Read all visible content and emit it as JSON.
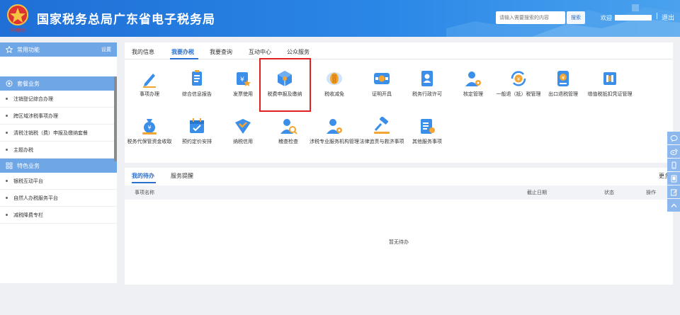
{
  "header": {
    "site_title": "国家税务总局广东省电子税务局",
    "search_placeholder": "请输入需要搜索的内容",
    "search_label": "搜索",
    "welcome": "欢迎",
    "separator": "|",
    "logout_label": "退出",
    "emblem_text": "中国税务"
  },
  "sidebar": {
    "common_title": "常用功能",
    "common_setting": "设置",
    "package_title": "套餐业务",
    "package_items": [
      "注销登记综合办理",
      "跨区域涉税事项办理",
      "清税注销税（费）申报及缴纳套餐",
      "主题办税"
    ],
    "special_title": "特色业务",
    "special_items": [
      "银税互动平台",
      "自然人办税服务平台",
      "减税降费专栏"
    ]
  },
  "main_tabs": [
    "我的信息",
    "我要办税",
    "我要查询",
    "互动中心",
    "公众服务"
  ],
  "active_tab": "我要办税",
  "tiles": [
    {
      "label": "事项办理",
      "icon": "pen-icon"
    },
    {
      "label": "综合信息报告",
      "icon": "report-icon"
    },
    {
      "label": "发票使用",
      "icon": "invoice-icon"
    },
    {
      "label": "税费申报及缴纳",
      "icon": "cube-icon"
    },
    {
      "label": "税收减免",
      "icon": "coins-icon"
    },
    {
      "label": "证明开具",
      "icon": "certificate-icon"
    },
    {
      "label": "税务行政许可",
      "icon": "license-icon"
    },
    {
      "label": "核定管理",
      "icon": "person-gear-icon"
    },
    {
      "label": "一般退（抵）税管理",
      "icon": "refund-icon"
    },
    {
      "label": "出口退税管理",
      "icon": "export-icon"
    },
    {
      "label": "增值税抵扣凭证管理",
      "icon": "voucher-icon"
    },
    {
      "label": "税务代保管资金收取",
      "icon": "money-bag-icon"
    },
    {
      "label": "预约定价安排",
      "icon": "calendar-icon"
    },
    {
      "label": "纳税信用",
      "icon": "credit-icon"
    },
    {
      "label": "稽查检查",
      "icon": "inspect-icon"
    },
    {
      "label": "涉税专业服务机构管理",
      "icon": "agency-icon"
    },
    {
      "label": "法律追责与救济事项",
      "icon": "gavel-icon"
    },
    {
      "label": "其他服务事项",
      "icon": "list-icon"
    }
  ],
  "todo": {
    "tab_active": "我的待办",
    "tab_other": "服务提醒",
    "more": "更多",
    "columns": [
      "事项名称",
      "截止日期",
      "状态",
      "操作"
    ],
    "empty_text": "暂无待办"
  },
  "float_icons": [
    "chat-icon",
    "weibo-icon",
    "mobile-icon",
    "tablet-icon",
    "edit-icon",
    "back-top-icon"
  ],
  "colors": {
    "primary": "#2b6fd0",
    "header": "#2a86e6",
    "highlight": "#e02020",
    "icon_blue": "#3b8fe8",
    "icon_orange": "#f3a533"
  }
}
